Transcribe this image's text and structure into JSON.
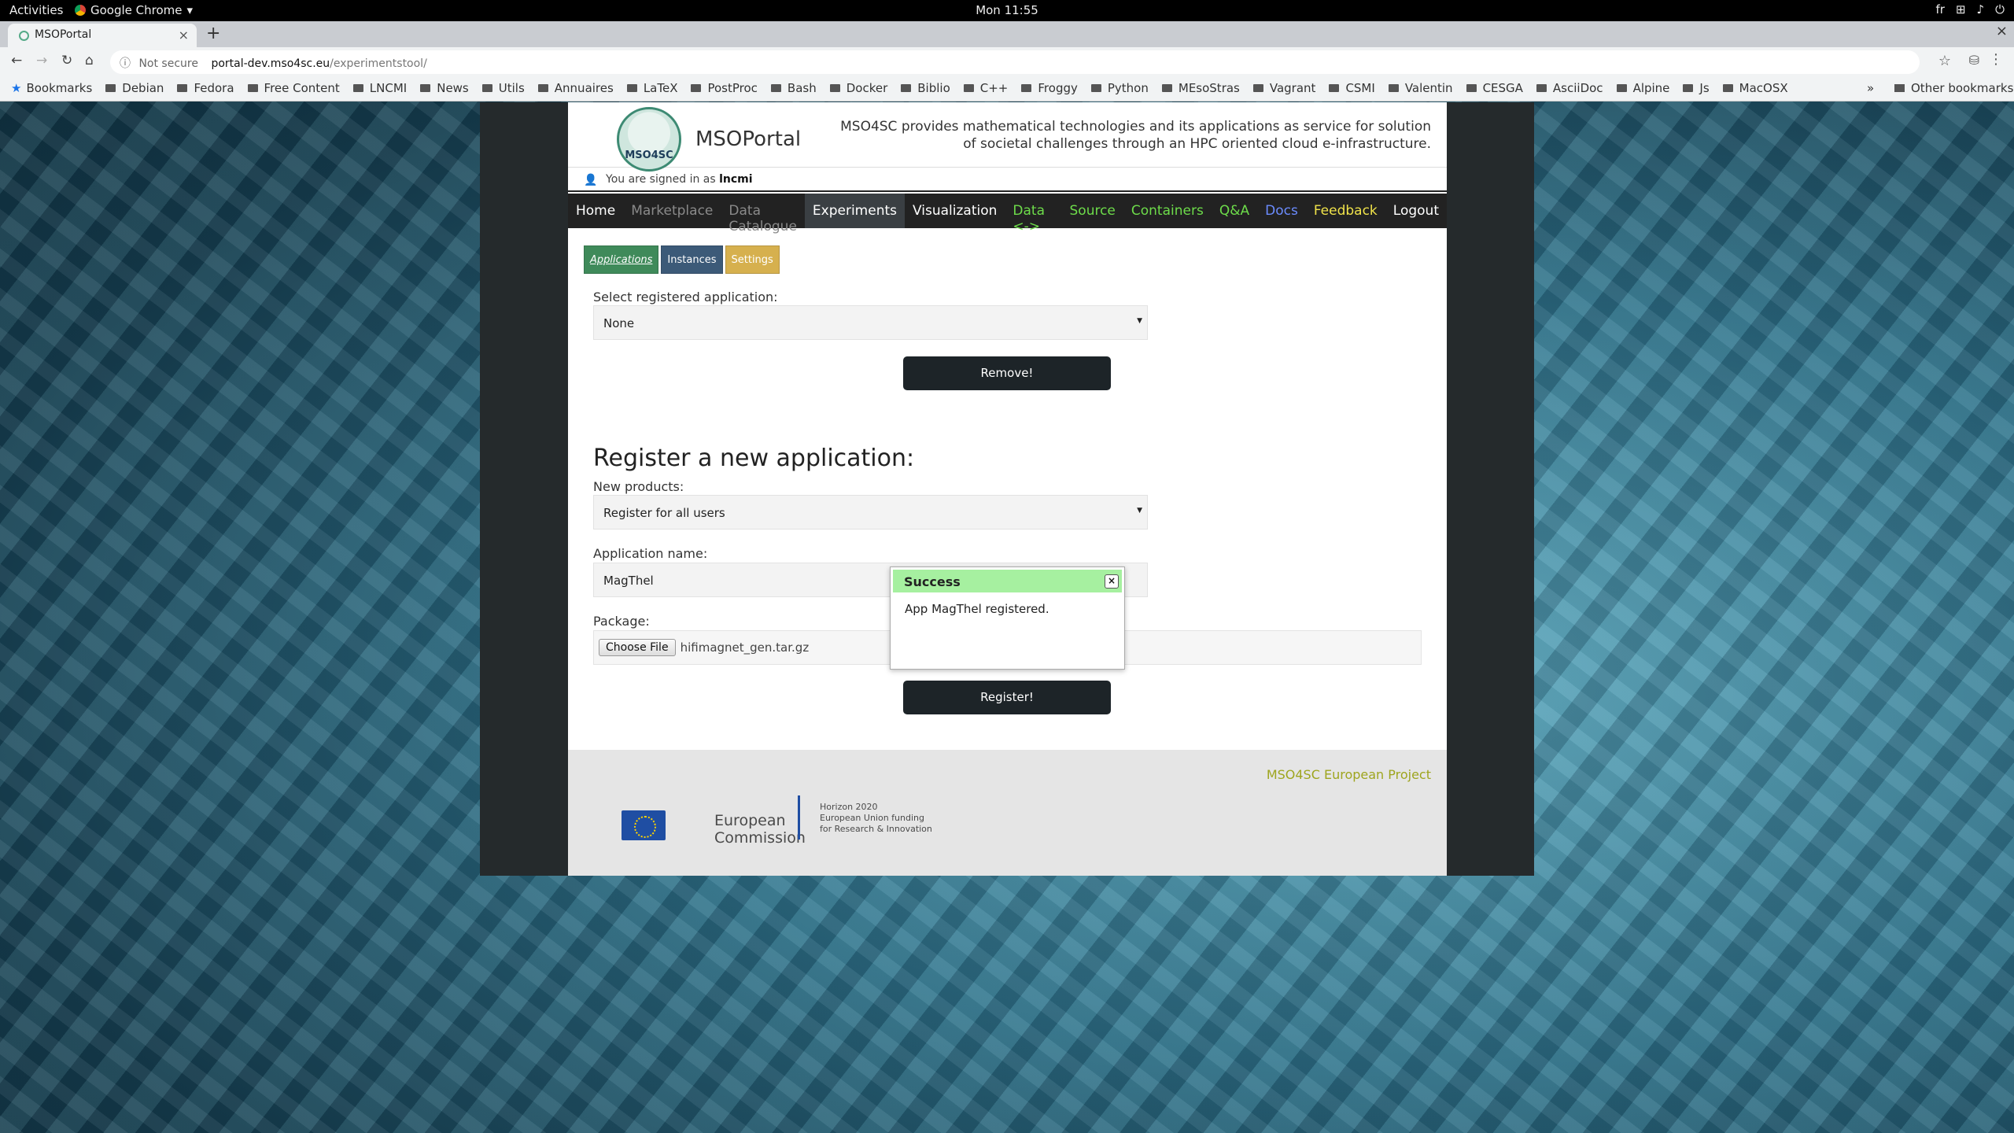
{
  "topbar": {
    "activities": "Activities",
    "app_name": "Google Chrome",
    "clock": "Mon 11:55",
    "lang": "fr"
  },
  "browser": {
    "tab_title": "MSOPortal",
    "not_secure": "Not secure",
    "url_host": "portal-dev.mso4sc.eu",
    "url_path": "/experimentstool/",
    "bookmarks": [
      "Bookmarks",
      "Debian",
      "Fedora",
      "Free Content",
      "LNCMI",
      "News",
      "Utils",
      "Annuaires",
      "LaTeX",
      "PostProc",
      "Bash",
      "Docker",
      "Biblio",
      "C++",
      "Froggy",
      "Python",
      "MEsoStras",
      "Vagrant",
      "CSMI",
      "Valentin",
      "CESGA",
      "AsciiDoc",
      "Alpine",
      "Js",
      "MacOSX"
    ],
    "more_bookmarks": "»",
    "other_bookmarks": "Other bookmarks"
  },
  "site": {
    "logo_text": "MSO4SC",
    "title": "MSOPortal",
    "tagline": "MSO4SC provides mathematical technologies and its applications as service for solution of societal challenges through an HPC oriented cloud e-infrastructure.",
    "signed_prefix": "You are signed in as",
    "username": "lncmi"
  },
  "nav": [
    {
      "label": "Home",
      "color": "#ffffff"
    },
    {
      "label": "Marketplace",
      "color": "#8a8a8a"
    },
    {
      "label": "Data Catalogue",
      "color": "#8a8a8a"
    },
    {
      "label": "Experiments",
      "color": "#ffffff"
    },
    {
      "label": "Visualization",
      "color": "#ffffff"
    },
    {
      "label": "Data <->",
      "color": "#6ddc4a"
    },
    {
      "label": "Source",
      "color": "#6ddc4a"
    },
    {
      "label": "Containers",
      "color": "#6ddc4a"
    },
    {
      "label": "Q&A",
      "color": "#6ddc4a"
    },
    {
      "label": "Docs",
      "color": "#6b8cff"
    },
    {
      "label": "Feedback",
      "color": "#f0e34a"
    },
    {
      "label": "Logout",
      "color": "#ffffff"
    }
  ],
  "subtabs": {
    "applications": "Applications",
    "instances": "Instances",
    "settings": "Settings"
  },
  "remove_form": {
    "label": "Select registered application:",
    "selected": "None",
    "button": "Remove!"
  },
  "register_form": {
    "heading": "Register a new application:",
    "products_label": "New products:",
    "products_selected": "Register for all users",
    "name_label": "Application name:",
    "name_value": "MagThel",
    "package_label": "Package:",
    "choose_file": "Choose File",
    "file_name": "hifimagnet_gen.tar.gz",
    "button": "Register!"
  },
  "footer": {
    "project_link": "MSO4SC European Project",
    "ec_line1": "European",
    "ec_line2": "Commission",
    "h2020_line1": "Horizon 2020",
    "h2020_line2": "European Union funding",
    "h2020_line3": "for Research & Innovation"
  },
  "dialog": {
    "title": "Success",
    "message": "App MagThel registered.",
    "close": "×"
  }
}
